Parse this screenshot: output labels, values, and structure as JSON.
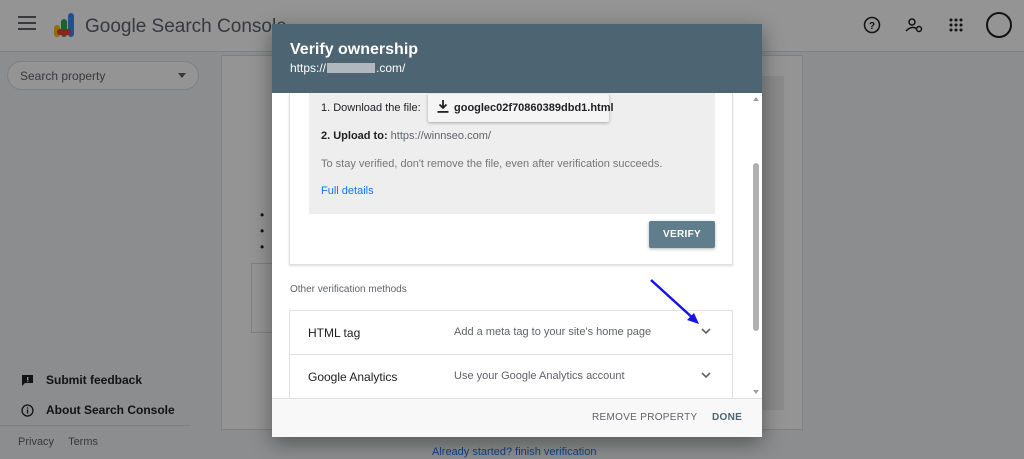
{
  "app": {
    "title": "Google Search Console",
    "search_property_placeholder": "Search property",
    "sidebar_links": [
      {
        "label": "Submit feedback",
        "icon": "feedback-icon"
      },
      {
        "label": "About Search Console",
        "icon": "info-icon"
      }
    ],
    "footer_links": [
      "Privacy",
      "Terms"
    ],
    "bottom_link": "Already started? finish verification"
  },
  "dialog": {
    "title": "Verify ownership",
    "url_prefix": "https://",
    "url_suffix": ".com/",
    "step1_label": "1. Download the file:",
    "download_file": "googlec02f70860389dbd1.html",
    "step2_label": "2. Upload to:",
    "step2_url": "https://winnseo.com/",
    "stay_verified_note": "To stay verified, don't remove the file, even after verification succeeds.",
    "full_details_link": "Full details",
    "verify_button": "VERIFY",
    "other_methods_label": "Other verification methods",
    "methods": [
      {
        "name": "HTML tag",
        "description": "Add a meta tag to your site's home page"
      },
      {
        "name": "Google Analytics",
        "description": "Use your Google Analytics account"
      }
    ],
    "remove_property_button": "REMOVE PROPERTY",
    "done_button": "DONE"
  },
  "colors": {
    "header": "#4d6473",
    "verify_button": "#607d8b",
    "link": "#1a73e8",
    "annotation_arrow": "#1414e6"
  }
}
